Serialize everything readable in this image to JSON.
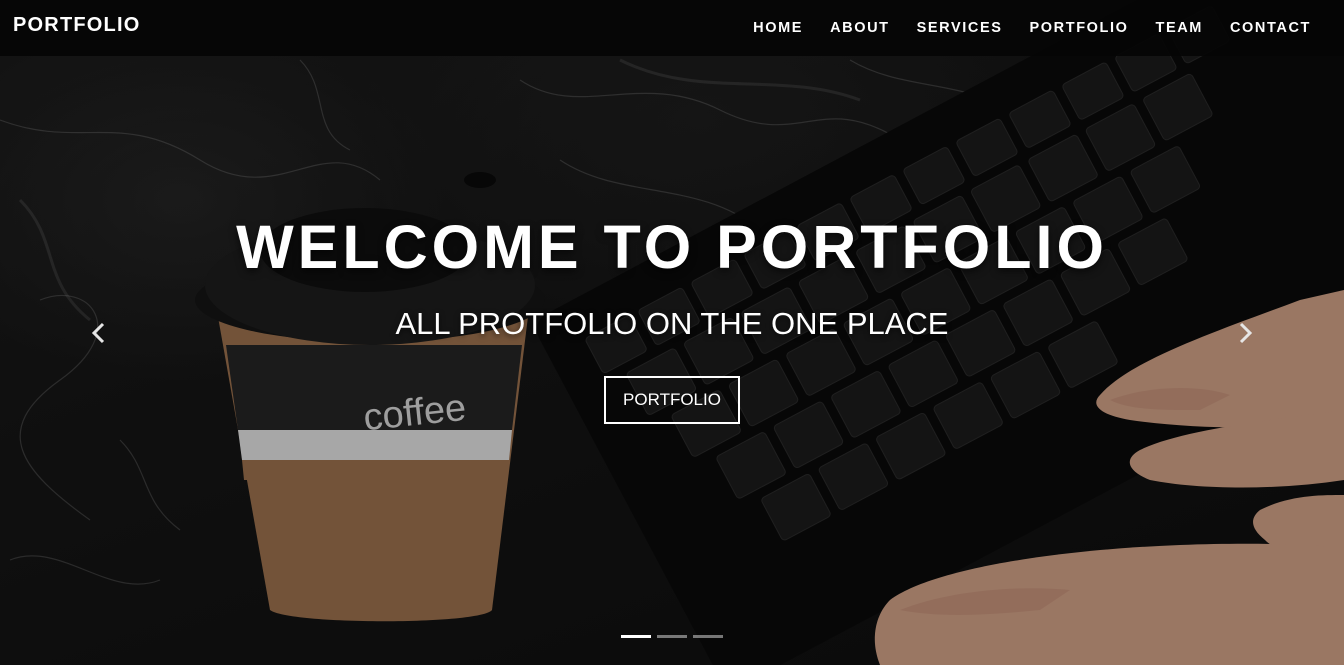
{
  "navbar": {
    "brand": "PORTFOLIO",
    "links": [
      "HOME",
      "ABOUT",
      "SERVICES",
      "PORTFOLIO",
      "TEAM",
      "CONTACT"
    ]
  },
  "hero": {
    "title": "WELCOME TO PORTFOLIO",
    "subtitle": "ALL PROTFOLIO ON THE ONE PLACE",
    "button_label": "PORTFOLIO",
    "cup_text": "coffee",
    "indicators": 3,
    "active_indicator": 0
  },
  "icons": {
    "prev": "chevron-left-icon",
    "next": "chevron-right-icon"
  },
  "colors": {
    "navbar_bg": "#050505",
    "text": "#ffffff",
    "cup_sleeve": "#9a6e47",
    "cup_band": "#2a2a2a"
  }
}
